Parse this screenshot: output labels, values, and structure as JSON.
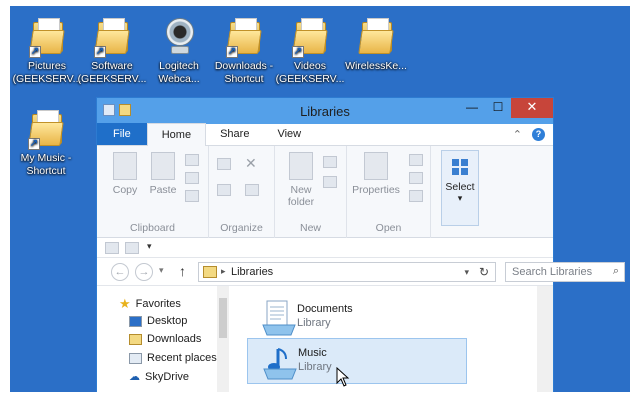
{
  "desktop": {
    "icons": [
      {
        "label1": "Pictures",
        "label2": "(GEEKSERV...",
        "type": "folder",
        "shortcut": true
      },
      {
        "label1": "Software",
        "label2": "(GEEKSERV...",
        "type": "folder",
        "shortcut": true
      },
      {
        "label1": "Logitech",
        "label2": "Webca...",
        "type": "webcam",
        "shortcut": false
      },
      {
        "label1": "Downloads -",
        "label2": "Shortcut",
        "type": "folder",
        "shortcut": true
      },
      {
        "label1": "Videos",
        "label2": "(GEEKSERV...",
        "type": "folder",
        "shortcut": true
      },
      {
        "label1": "WirelessKe...",
        "label2": "",
        "type": "folder",
        "shortcut": false
      },
      {
        "label1": "My Music -",
        "label2": "Shortcut",
        "type": "folder",
        "shortcut": true
      }
    ]
  },
  "window": {
    "title": "Libraries",
    "controls": {
      "minimize": "—",
      "maximize": "☐",
      "close": "✕"
    },
    "tabs": [
      {
        "label": "File"
      },
      {
        "label": "Home"
      },
      {
        "label": "Share"
      },
      {
        "label": "View"
      }
    ],
    "tab_right": {
      "chevron": "⌃",
      "help": "?"
    },
    "ribbon": {
      "clipboard": {
        "copy": "Copy",
        "paste": "Paste",
        "label": "Clipboard"
      },
      "organize": {
        "label": "Organize"
      },
      "new": {
        "new_folder_1": "New",
        "new_folder_2": "folder",
        "label": "New"
      },
      "open": {
        "properties": "Properties",
        "label": "Open"
      },
      "select": {
        "label": "Select",
        "arrow": "▾"
      }
    },
    "qat_arrow": "▾",
    "address": {
      "back": "←",
      "forward": "→",
      "dropdown": "▾",
      "up": "↑",
      "crumb": "Libraries",
      "sep": "▸",
      "history": "▾",
      "refresh": "↻",
      "search_placeholder": "Search Libraries",
      "search_icon": "⌕"
    },
    "nav": {
      "favorites": "Favorites",
      "desktop": "Desktop",
      "downloads": "Downloads",
      "recent": "Recent places",
      "skydrive": "SkyDrive"
    },
    "libraries": [
      {
        "name": "Documents",
        "type": "Library",
        "selected": false
      },
      {
        "name": "Music",
        "type": "Library",
        "selected": true
      }
    ]
  },
  "colors": {
    "desktop": "#2b6fc7",
    "titlebar": "#54a0e9",
    "file_tab": "#1f6fc9",
    "close": "#c7453a"
  }
}
